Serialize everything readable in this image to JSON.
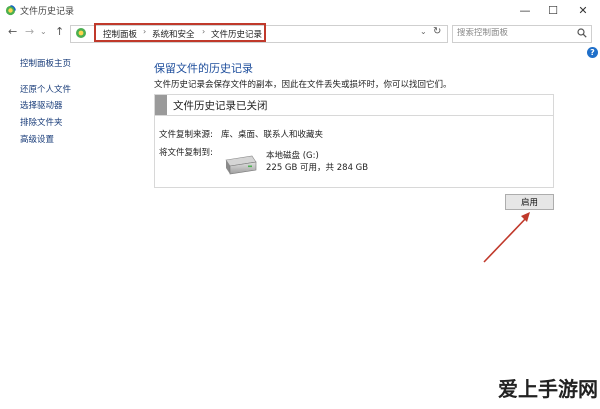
{
  "window": {
    "title": "文件历史记录",
    "minimize_glyph": "—",
    "maximize_glyph": "☐",
    "close_glyph": "✕"
  },
  "nav": {
    "back_glyph": "←",
    "forward_glyph": "→",
    "dropdown_glyph": "⌄",
    "up_glyph": "↑",
    "breadcrumbs": [
      "控制面板",
      "系统和安全",
      "文件历史记录"
    ],
    "separator": "›",
    "address_dropdown_glyph": "⌄",
    "refresh_glyph": "↻"
  },
  "search": {
    "placeholder": "搜索控制面板"
  },
  "help_glyph": "?",
  "sidebar": {
    "items": [
      "控制面板主页",
      "还原个人文件",
      "选择驱动器",
      "排除文件夹",
      "高级设置"
    ]
  },
  "main": {
    "heading": "保留文件的历史记录",
    "description": "文件历史记录会保存文件的副本，因此在文件丢失或损坏时，你可以找回它们。",
    "panel_title": "文件历史记录已关闭",
    "source_label": "文件复制来源:",
    "source_value": "库、桌面、联系人和收藏夹",
    "dest_label": "将文件复制到:",
    "drive_name": "本地磁盘 (G:)",
    "drive_space": "225 GB 可用，共 284 GB",
    "enable_label": "启用"
  },
  "colors": {
    "annotation": "#c0392b",
    "heading": "#1e4e9c",
    "link": "#1a3d7a"
  },
  "watermark": "爱上手游网"
}
